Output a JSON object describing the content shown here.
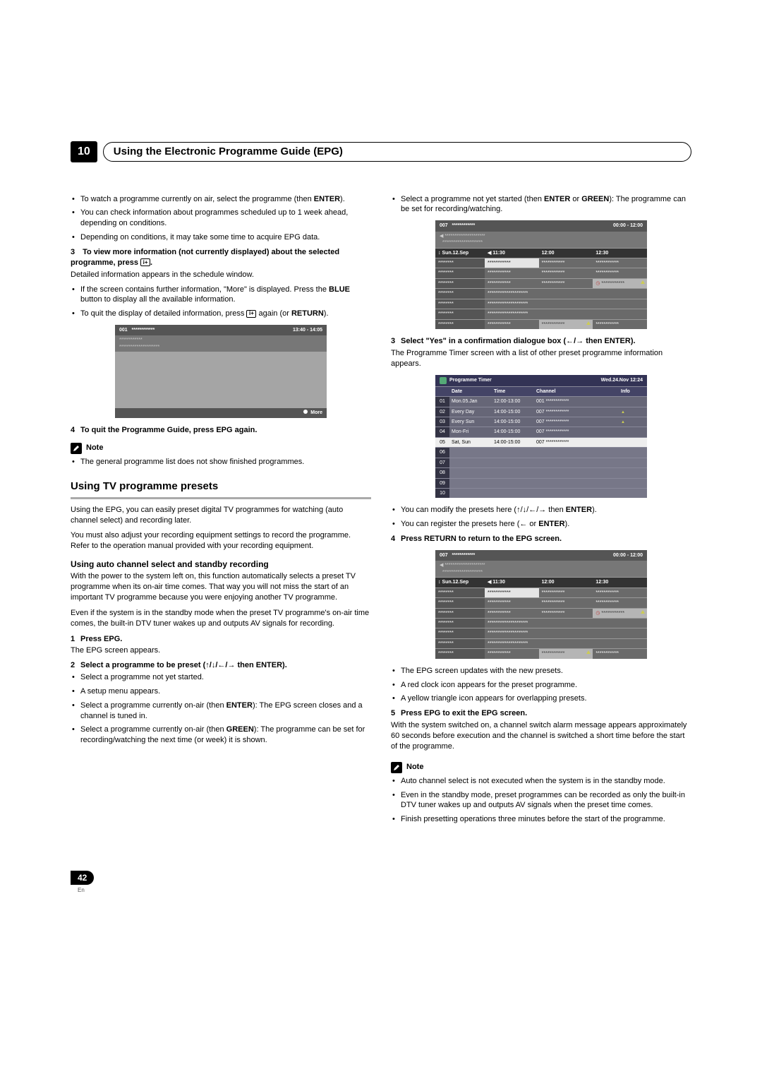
{
  "chapter": {
    "num": "10",
    "title": "Using the Electronic Programme Guide (EPG)"
  },
  "left": {
    "intro_bullets": [
      "To watch a programme currently on air, select the programme (then ",
      ").",
      "You can check information about programmes scheduled up to 1 week ahead, depending on conditions.",
      "Depending on conditions, it may take some time to acquire EPG data."
    ],
    "enter": "ENTER",
    "step3_head": "To view more information (not currently displayed) about the selected programme, press ",
    "step3_tail": ".",
    "step3_after": "Detailed information appears in the schedule window.",
    "step3_bullets_a": "If the screen contains further information, \"More\" is displayed. Press the ",
    "step3_bullets_a_mid": " button to display all the available information.",
    "blue": "BLUE",
    "step3_bullets_b_pre": "To quit the display of detailed information, press ",
    "step3_bullets_b_post": " again (or ",
    "step3_bullets_b_end": ").",
    "return": "RETURN",
    "detail_box": {
      "ch": "001",
      "time": "13:40 - 14:05",
      "more": "More"
    },
    "step4": "To quit the Programme Guide, press EPG again.",
    "note_label": "Note",
    "note1": "The general programme list does not show finished programmes.",
    "h2": "Using TV programme presets",
    "p1": "Using the EPG, you can easily preset digital TV programmes for watching (auto channel select) and recording later.",
    "p2": "You must also adjust your recording equipment settings to record the programme. Refer to the operation manual provided with your recording equipment.",
    "h3": "Using auto channel select and standby recording",
    "p3": "With the power to the system left on, this function automatically selects a preset TV programme when its on-air time comes. That way you will not miss the start of an important TV programme because you were enjoying another TV programme.",
    "p4": "Even if the system is in the standby mode when the preset TV programme's on-air time comes, the built-in DTV tuner wakes up and outputs AV signals for recording.",
    "s1_head": "Press EPG.",
    "s1_after": "The EPG screen appears.",
    "s2_head": "Select a programme to be preset (↑/↓/←/→ then ENTER).",
    "s2_bullets": [
      "Select a programme not yet started.",
      "A setup menu appears."
    ],
    "s2_b3_pre": "Select a programme currently on-air (then ",
    "s2_b3_post": "): The EPG screen closes and a channel is tuned in.",
    "s2_b4_pre": "Select a programme currently on-air (then ",
    "s2_b4_post": "): The programme can be set for recording/watching the next time (or week) it is shown.",
    "green": "GREEN"
  },
  "right": {
    "top_bullet_pre": "Select a programme not yet started (then ",
    "top_bullet_mid": " or ",
    "top_bullet_post": "): The programme can be set for recording/watching.",
    "enter": "ENTER",
    "green": "GREEN",
    "step3_head": "Select \"Yes\" in a confirmation dialogue box (←/→ then ENTER).",
    "step3_after": "The Programme Timer screen with a list of other preset programme information appears.",
    "timer": {
      "title": "Programme Timer",
      "datehead": "Wed.24.Nov 12:24",
      "cols": [
        "",
        "Date",
        "Time",
        "Channel",
        "Info"
      ],
      "rows": [
        [
          "01",
          "Mon.05.Jan",
          "12:00-13:00",
          "001 ************",
          ""
        ],
        [
          "02",
          "Every Day",
          "14:00-15:00",
          "007 ************",
          "tri"
        ],
        [
          "03",
          "Every Sun",
          "14:00-15:00",
          "007 ************",
          "tri"
        ],
        [
          "04",
          "Mon-Fri",
          "14:00-15:00",
          "007 ************",
          ""
        ],
        [
          "05",
          "Sat, Sun",
          "14:00-15:00",
          "007 ************",
          ""
        ]
      ],
      "empty": [
        "06",
        "07",
        "08",
        "09",
        "10"
      ]
    },
    "mod_bullets_a_pre": "You can modify the presets here (",
    "mod_bullets_a_mid": "↑/↓/←/→",
    "mod_bullets_a_post": " then ",
    "mod_bullets_a_end": ").",
    "mod_bullets_b_pre": "You can register the presets here (",
    "mod_bullets_b_mid": "←",
    "mod_bullets_b_post": " or ",
    "mod_bullets_b_end": ").",
    "step4": "Press RETURN to return to the EPG screen.",
    "below_bullets": [
      "The EPG screen updates with the new presets.",
      "A red clock icon appears for the preset programme.",
      "A yellow triangle icon appears for overlapping presets."
    ],
    "step5_head": "Press EPG to exit the EPG screen.",
    "step5_after": "With the system switched on, a channel switch alarm message appears approximately 60 seconds before execution and the channel is switched a short time before the start of the programme.",
    "note_label": "Note",
    "note_bullets": [
      "Auto channel select is not executed when the system is in the standby mode.",
      "Even in the standby mode, preset programmes can be recorded as only the built-in DTV tuner wakes up and outputs AV signals when the preset time comes.",
      "Finish presetting operations three minutes before the start of the programme."
    ]
  },
  "epg": {
    "ch": "007",
    "range": "00:00 - 12:00",
    "day": "Sun.12.Sep",
    "times": [
      "11:30",
      "12:00",
      "12:30"
    ],
    "rows": 7
  },
  "page": {
    "num": "42",
    "lang": "En"
  }
}
